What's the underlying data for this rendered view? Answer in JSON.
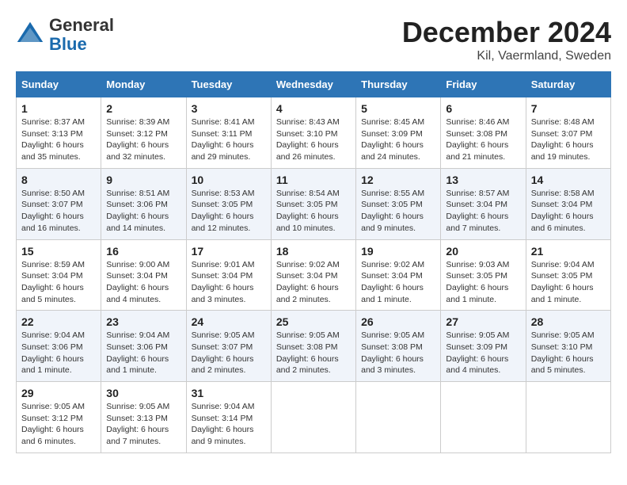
{
  "logo": {
    "general": "General",
    "blue": "Blue"
  },
  "title": "December 2024",
  "location": "Kil, Vaermland, Sweden",
  "days_of_week": [
    "Sunday",
    "Monday",
    "Tuesday",
    "Wednesday",
    "Thursday",
    "Friday",
    "Saturday"
  ],
  "weeks": [
    [
      {
        "day": "1",
        "sunrise": "8:37 AM",
        "sunset": "3:13 PM",
        "daylight": "6 hours and 35 minutes."
      },
      {
        "day": "2",
        "sunrise": "8:39 AM",
        "sunset": "3:12 PM",
        "daylight": "6 hours and 32 minutes."
      },
      {
        "day": "3",
        "sunrise": "8:41 AM",
        "sunset": "3:11 PM",
        "daylight": "6 hours and 29 minutes."
      },
      {
        "day": "4",
        "sunrise": "8:43 AM",
        "sunset": "3:10 PM",
        "daylight": "6 hours and 26 minutes."
      },
      {
        "day": "5",
        "sunrise": "8:45 AM",
        "sunset": "3:09 PM",
        "daylight": "6 hours and 24 minutes."
      },
      {
        "day": "6",
        "sunrise": "8:46 AM",
        "sunset": "3:08 PM",
        "daylight": "6 hours and 21 minutes."
      },
      {
        "day": "7",
        "sunrise": "8:48 AM",
        "sunset": "3:07 PM",
        "daylight": "6 hours and 19 minutes."
      }
    ],
    [
      {
        "day": "8",
        "sunrise": "8:50 AM",
        "sunset": "3:07 PM",
        "daylight": "6 hours and 16 minutes."
      },
      {
        "day": "9",
        "sunrise": "8:51 AM",
        "sunset": "3:06 PM",
        "daylight": "6 hours and 14 minutes."
      },
      {
        "day": "10",
        "sunrise": "8:53 AM",
        "sunset": "3:05 PM",
        "daylight": "6 hours and 12 minutes."
      },
      {
        "day": "11",
        "sunrise": "8:54 AM",
        "sunset": "3:05 PM",
        "daylight": "6 hours and 10 minutes."
      },
      {
        "day": "12",
        "sunrise": "8:55 AM",
        "sunset": "3:05 PM",
        "daylight": "6 hours and 9 minutes."
      },
      {
        "day": "13",
        "sunrise": "8:57 AM",
        "sunset": "3:04 PM",
        "daylight": "6 hours and 7 minutes."
      },
      {
        "day": "14",
        "sunrise": "8:58 AM",
        "sunset": "3:04 PM",
        "daylight": "6 hours and 6 minutes."
      }
    ],
    [
      {
        "day": "15",
        "sunrise": "8:59 AM",
        "sunset": "3:04 PM",
        "daylight": "6 hours and 5 minutes."
      },
      {
        "day": "16",
        "sunrise": "9:00 AM",
        "sunset": "3:04 PM",
        "daylight": "6 hours and 4 minutes."
      },
      {
        "day": "17",
        "sunrise": "9:01 AM",
        "sunset": "3:04 PM",
        "daylight": "6 hours and 3 minutes."
      },
      {
        "day": "18",
        "sunrise": "9:02 AM",
        "sunset": "3:04 PM",
        "daylight": "6 hours and 2 minutes."
      },
      {
        "day": "19",
        "sunrise": "9:02 AM",
        "sunset": "3:04 PM",
        "daylight": "6 hours and 1 minute."
      },
      {
        "day": "20",
        "sunrise": "9:03 AM",
        "sunset": "3:05 PM",
        "daylight": "6 hours and 1 minute."
      },
      {
        "day": "21",
        "sunrise": "9:04 AM",
        "sunset": "3:05 PM",
        "daylight": "6 hours and 1 minute."
      }
    ],
    [
      {
        "day": "22",
        "sunrise": "9:04 AM",
        "sunset": "3:06 PM",
        "daylight": "6 hours and 1 minute."
      },
      {
        "day": "23",
        "sunrise": "9:04 AM",
        "sunset": "3:06 PM",
        "daylight": "6 hours and 1 minute."
      },
      {
        "day": "24",
        "sunrise": "9:05 AM",
        "sunset": "3:07 PM",
        "daylight": "6 hours and 2 minutes."
      },
      {
        "day": "25",
        "sunrise": "9:05 AM",
        "sunset": "3:08 PM",
        "daylight": "6 hours and 2 minutes."
      },
      {
        "day": "26",
        "sunrise": "9:05 AM",
        "sunset": "3:08 PM",
        "daylight": "6 hours and 3 minutes."
      },
      {
        "day": "27",
        "sunrise": "9:05 AM",
        "sunset": "3:09 PM",
        "daylight": "6 hours and 4 minutes."
      },
      {
        "day": "28",
        "sunrise": "9:05 AM",
        "sunset": "3:10 PM",
        "daylight": "6 hours and 5 minutes."
      }
    ],
    [
      {
        "day": "29",
        "sunrise": "9:05 AM",
        "sunset": "3:12 PM",
        "daylight": "6 hours and 6 minutes."
      },
      {
        "day": "30",
        "sunrise": "9:05 AM",
        "sunset": "3:13 PM",
        "daylight": "6 hours and 7 minutes."
      },
      {
        "day": "31",
        "sunrise": "9:04 AM",
        "sunset": "3:14 PM",
        "daylight": "6 hours and 9 minutes."
      },
      null,
      null,
      null,
      null
    ]
  ],
  "labels": {
    "sunrise": "Sunrise:",
    "sunset": "Sunset:",
    "daylight": "Daylight:"
  }
}
